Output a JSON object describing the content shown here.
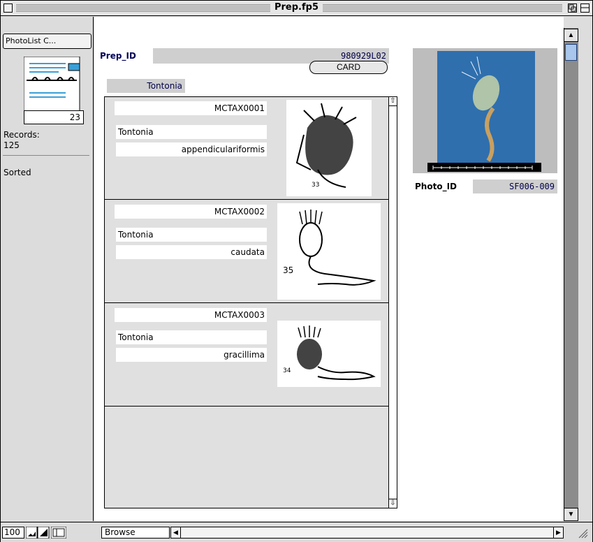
{
  "window": {
    "title": "Prep.fp5"
  },
  "status": {
    "layout_name": "PhotoList C...",
    "record_number": "23",
    "records_label": "Records:",
    "records_count": "125",
    "sort_state": "Sorted"
  },
  "header": {
    "prep_id_label": "Prep_ID",
    "prep_id_value": "980929L02",
    "genus_value": "Tontonia",
    "card_button": "CARD"
  },
  "portal_rows": [
    {
      "code": "MCTAX0001",
      "genus": "Tontonia",
      "species": "appendiculariformis",
      "figure_number": "33"
    },
    {
      "code": "MCTAX0002",
      "genus": "Tontonia",
      "species": "caudata",
      "figure_number": "35"
    },
    {
      "code": "MCTAX0003",
      "genus": "Tontonia",
      "species": "gracillima",
      "figure_number": "34"
    }
  ],
  "photo": {
    "photo_id_label": "Photo_ID",
    "photo_id_value": "SF006-009"
  },
  "bottom": {
    "zoom": "100",
    "mode": "Browse"
  },
  "icons": [
    "close-box-icon",
    "zoom-box-icon",
    "collapse-box-icon",
    "book-icon",
    "scroll-up-arrow-icon",
    "scroll-down-arrow-icon",
    "scroll-left-arrow-icon",
    "scroll-right-arrow-icon",
    "resize-grip-icon",
    "zoom-out-icon",
    "zoom-in-icon",
    "status-area-toggle-icon"
  ],
  "colors": {
    "window_bg": "#dddddd",
    "field_grey": "#cfcfcf",
    "photo_blue": "#2f6fae",
    "scroll_thumb": "#a9c7ec"
  }
}
